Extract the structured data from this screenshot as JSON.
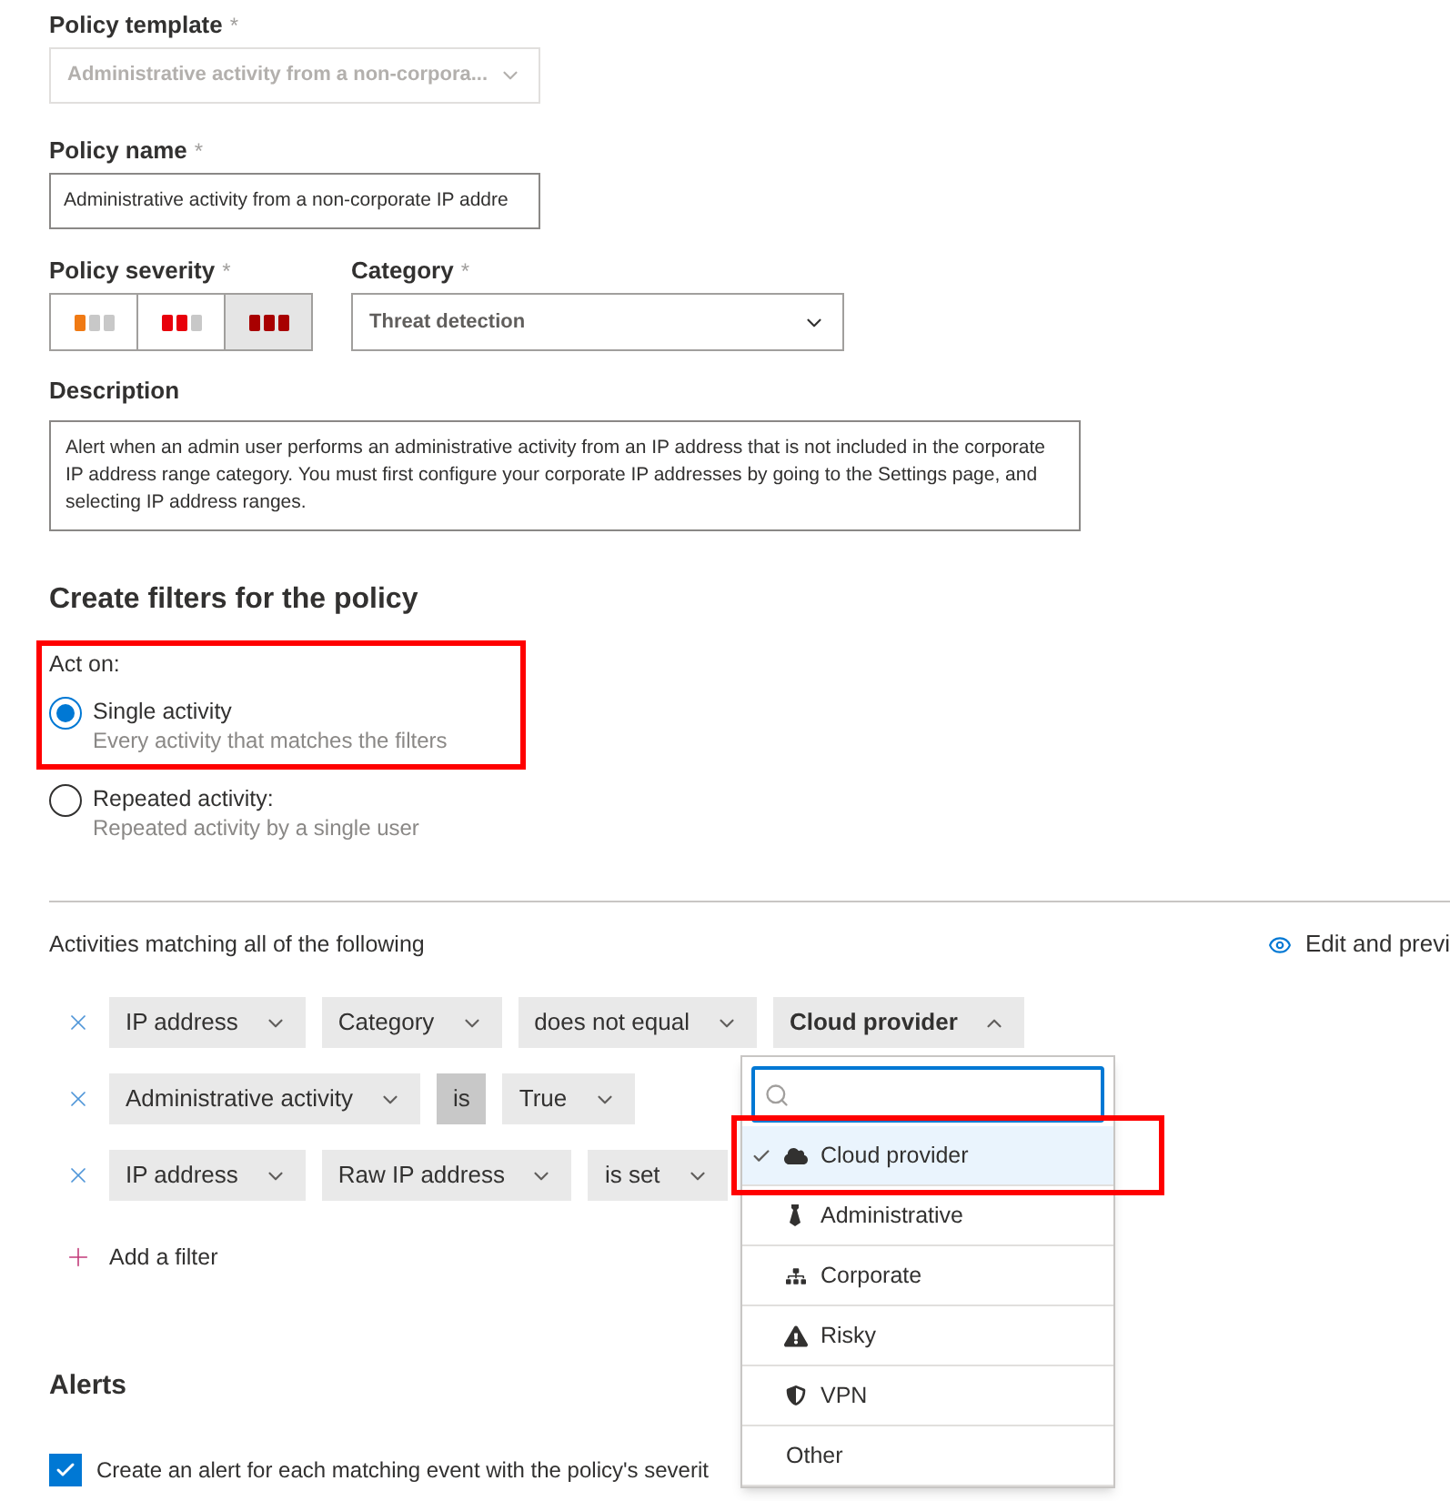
{
  "policy_template": {
    "label": "Policy template",
    "required_mark": "*",
    "value": "Administrative activity from a non-corpora...",
    "disabled": true
  },
  "policy_name": {
    "label": "Policy name",
    "required_mark": "*",
    "value": "Administrative activity from a non-corporate IP addre"
  },
  "policy_severity": {
    "label": "Policy severity",
    "required_mark": "*",
    "options": [
      {
        "kind": "low",
        "selected": false
      },
      {
        "kind": "medium",
        "selected": false
      },
      {
        "kind": "high",
        "selected": true
      }
    ]
  },
  "category": {
    "label": "Category",
    "required_mark": "*",
    "value": "Threat detection"
  },
  "description": {
    "label": "Description",
    "value": "Alert when an admin user performs an administrative activity from an IP address that is not included in the corporate IP address range category. You must first configure your corporate IP addresses by going to the Settings page, and selecting IP address ranges."
  },
  "filters_heading": "Create filters for the policy",
  "act_on": {
    "label": "Act on:",
    "options": [
      {
        "label": "Single activity",
        "hint": "Every activity that matches the filters",
        "selected": true
      },
      {
        "label": "Repeated activity:",
        "hint": "Repeated activity by a single user",
        "selected": false
      }
    ]
  },
  "activities": {
    "heading": "Activities matching all of the following",
    "preview_link": "Edit and previ",
    "rows": [
      {
        "parts": [
          {
            "kind": "dropdown",
            "text": "IP address",
            "expanded": false
          },
          {
            "kind": "dropdown",
            "text": "Category",
            "expanded": false
          },
          {
            "kind": "dropdown",
            "text": "does not equal",
            "expanded": false
          },
          {
            "kind": "dropdown",
            "text": "Cloud provider",
            "expanded": true
          }
        ]
      },
      {
        "parts": [
          {
            "kind": "dropdown",
            "text": "Administrative activity",
            "expanded": false
          },
          {
            "kind": "static",
            "text": "is"
          },
          {
            "kind": "dropdown",
            "text": "True",
            "expanded": false
          }
        ]
      },
      {
        "parts": [
          {
            "kind": "dropdown",
            "text": "IP address",
            "expanded": false
          },
          {
            "kind": "dropdown",
            "text": "Raw IP address",
            "expanded": false
          },
          {
            "kind": "dropdown",
            "text": "is set",
            "expanded": false
          }
        ]
      }
    ],
    "add_filter": "Add a filter"
  },
  "dropdown_menu": {
    "options": [
      {
        "kind": "cloud",
        "label": "Cloud provider",
        "selected": true
      },
      {
        "kind": "tie",
        "label": "Administrative",
        "selected": false
      },
      {
        "kind": "network",
        "label": "Corporate",
        "selected": false
      },
      {
        "kind": "warning",
        "label": "Risky",
        "selected": false
      },
      {
        "kind": "shield",
        "label": "VPN",
        "selected": false
      },
      {
        "kind": "plain",
        "label": "Other",
        "selected": false
      }
    ]
  },
  "alerts": {
    "heading": "Alerts",
    "create_alert": {
      "label": "Create an alert for each matching event with the policy's severit",
      "checked": true
    }
  }
}
